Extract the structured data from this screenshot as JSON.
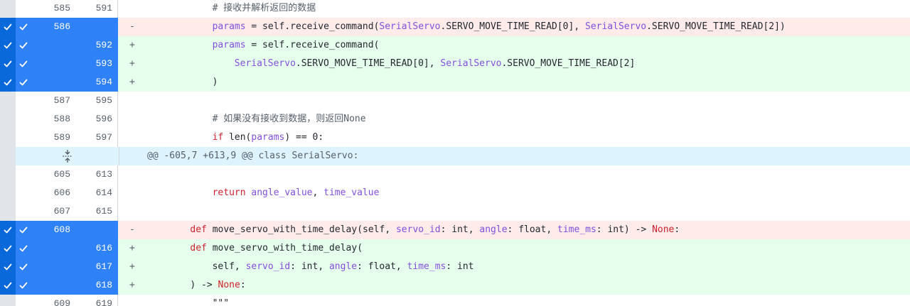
{
  "colors": {
    "selected": "#2f81f7",
    "added_bg": "#e6ffec",
    "deleted_bg": "#ffebe9",
    "hunk_bg": "#ddf4ff"
  },
  "rows": [
    {
      "kind": "ctx",
      "old": "585",
      "new": "591",
      "sign": "",
      "indent": 12,
      "tokens": [
        {
          "t": "# 接收并解析返回的数据",
          "c": "cm"
        }
      ]
    },
    {
      "kind": "del",
      "sel": true,
      "old": "586",
      "new": "",
      "sign": "-",
      "indent": 12,
      "tokens": [
        {
          "t": "params",
          "c": "prm"
        },
        {
          "t": " = self.receive_command(",
          "c": ""
        },
        {
          "t": "SerialServo",
          "c": "cls"
        },
        {
          "t": ".SERVO_MOVE_TIME_READ[0], ",
          "c": ""
        },
        {
          "t": "SerialServo",
          "c": "cls"
        },
        {
          "t": ".SERVO_MOVE_TIME_READ[2])",
          "c": ""
        }
      ]
    },
    {
      "kind": "add",
      "sel": true,
      "old": "",
      "new": "592",
      "sign": "+",
      "indent": 12,
      "tokens": [
        {
          "t": "params",
          "c": "prm"
        },
        {
          "t": " = self.receive_command(",
          "c": ""
        }
      ]
    },
    {
      "kind": "add",
      "sel": true,
      "old": "",
      "new": "593",
      "sign": "+",
      "indent": 16,
      "tokens": [
        {
          "t": "SerialServo",
          "c": "cls"
        },
        {
          "t": ".SERVO_MOVE_TIME_READ[0], ",
          "c": ""
        },
        {
          "t": "SerialServo",
          "c": "cls"
        },
        {
          "t": ".SERVO_MOVE_TIME_READ[2]",
          "c": ""
        }
      ]
    },
    {
      "kind": "add",
      "sel": true,
      "old": "",
      "new": "594",
      "sign": "+",
      "indent": 12,
      "tokens": [
        {
          "t": ")",
          "c": ""
        }
      ]
    },
    {
      "kind": "ctx",
      "old": "587",
      "new": "595",
      "sign": "",
      "indent": 0,
      "tokens": []
    },
    {
      "kind": "ctx",
      "old": "588",
      "new": "596",
      "sign": "",
      "indent": 12,
      "tokens": [
        {
          "t": "# 如果没有接收到数据，则返回None",
          "c": "cm"
        }
      ]
    },
    {
      "kind": "ctx",
      "old": "589",
      "new": "597",
      "sign": "",
      "indent": 12,
      "tokens": [
        {
          "t": "if",
          "c": "kw"
        },
        {
          "t": " len(",
          "c": ""
        },
        {
          "t": "params",
          "c": "prm"
        },
        {
          "t": ") == 0:",
          "c": ""
        }
      ]
    },
    {
      "kind": "hunk",
      "text": "@@ -605,7 +613,9 @@ class SerialServo:"
    },
    {
      "kind": "ctx",
      "old": "605",
      "new": "613",
      "sign": "",
      "indent": 0,
      "tokens": []
    },
    {
      "kind": "ctx",
      "old": "606",
      "new": "614",
      "sign": "",
      "indent": 12,
      "tokens": [
        {
          "t": "return",
          "c": "kw"
        },
        {
          "t": " ",
          "c": ""
        },
        {
          "t": "angle_value",
          "c": "prm"
        },
        {
          "t": ", ",
          "c": ""
        },
        {
          "t": "time_value",
          "c": "prm"
        }
      ]
    },
    {
      "kind": "ctx",
      "old": "607",
      "new": "615",
      "sign": "",
      "indent": 0,
      "tokens": []
    },
    {
      "kind": "del",
      "sel": true,
      "old": "608",
      "new": "",
      "sign": "-",
      "indent": 8,
      "tokens": [
        {
          "t": "def",
          "c": "kw"
        },
        {
          "t": " move_servo_with_time_delay(self, ",
          "c": ""
        },
        {
          "t": "servo_id",
          "c": "prm"
        },
        {
          "t": ": int, ",
          "c": ""
        },
        {
          "t": "angle",
          "c": "prm"
        },
        {
          "t": ": float, ",
          "c": ""
        },
        {
          "t": "time_ms",
          "c": "prm"
        },
        {
          "t": ": int) -> ",
          "c": ""
        },
        {
          "t": "None",
          "c": "kw"
        },
        {
          "t": ":",
          "c": ""
        }
      ]
    },
    {
      "kind": "add",
      "sel": true,
      "old": "",
      "new": "616",
      "sign": "+",
      "indent": 8,
      "tokens": [
        {
          "t": "def",
          "c": "kw"
        },
        {
          "t": " move_servo_with_time_delay(",
          "c": ""
        }
      ]
    },
    {
      "kind": "add",
      "sel": true,
      "old": "",
      "new": "617",
      "sign": "+",
      "indent": 12,
      "tokens": [
        {
          "t": "self, ",
          "c": ""
        },
        {
          "t": "servo_id",
          "c": "prm"
        },
        {
          "t": ": int, ",
          "c": ""
        },
        {
          "t": "angle",
          "c": "prm"
        },
        {
          "t": ": float, ",
          "c": ""
        },
        {
          "t": "time_ms",
          "c": "prm"
        },
        {
          "t": ": int",
          "c": ""
        }
      ]
    },
    {
      "kind": "add",
      "sel": true,
      "old": "",
      "new": "618",
      "sign": "+",
      "indent": 8,
      "tokens": [
        {
          "t": ") -> ",
          "c": ""
        },
        {
          "t": "None",
          "c": "kw"
        },
        {
          "t": ":",
          "c": ""
        }
      ]
    },
    {
      "kind": "ctx",
      "old": "609",
      "new": "619",
      "sign": "",
      "indent": 12,
      "tokens": [
        {
          "t": "\"\"\"",
          "c": ""
        }
      ]
    }
  ]
}
